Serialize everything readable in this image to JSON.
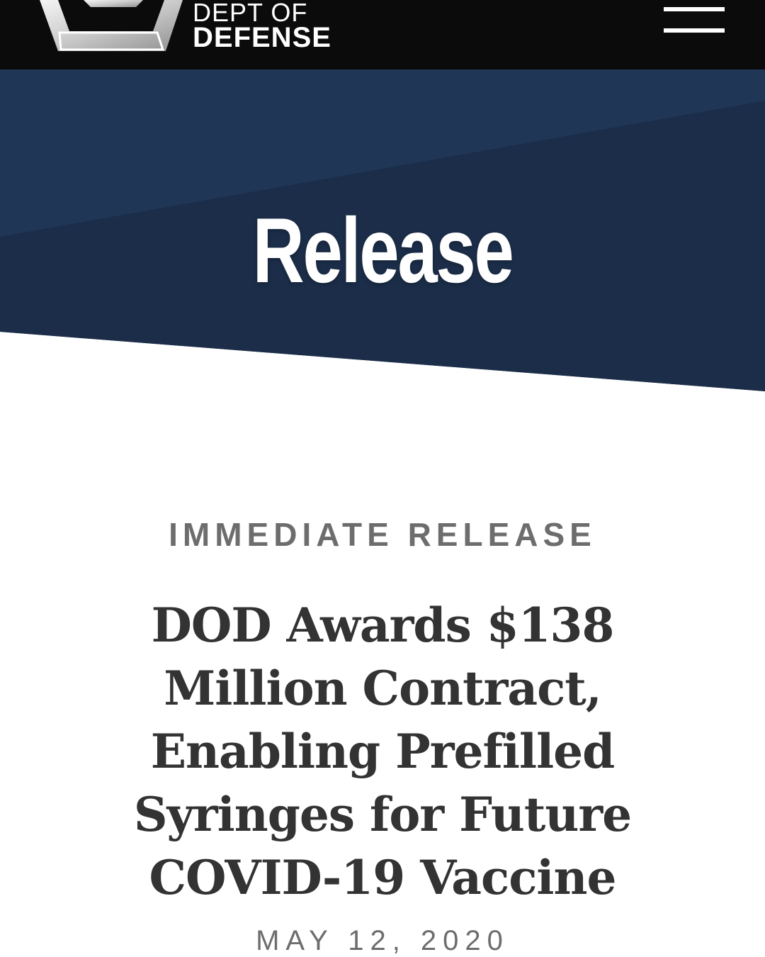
{
  "header": {
    "logo_line1": "DEPT OF",
    "logo_line2": "DEFENSE",
    "logo_icon": "pentagon-logo-icon",
    "menu_icon": "hamburger-menu-icon"
  },
  "hero": {
    "title": "Release"
  },
  "article": {
    "kicker": "IMMEDIATE RELEASE",
    "headline": "DOD Awards $138 Million Contract, Enabling Prefilled Syringes for Future COVID-19 Vaccine",
    "date": "MAY 12, 2020"
  },
  "colors": {
    "topbar": "#0b0b0c",
    "hero_primary": "#1f3656",
    "hero_secondary": "#1b2d48",
    "text_dark": "#333333",
    "text_gray": "#6d6d6d"
  }
}
